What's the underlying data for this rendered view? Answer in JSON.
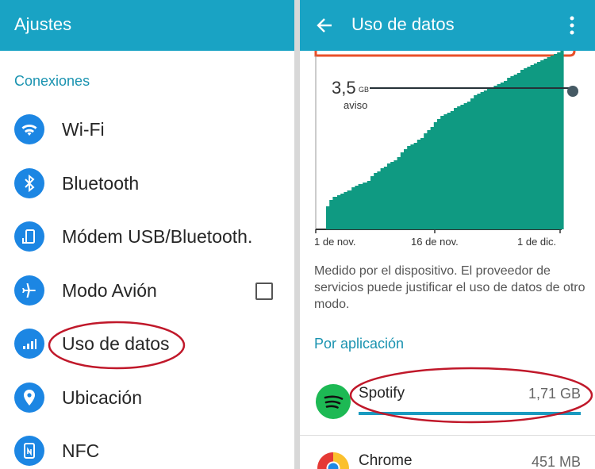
{
  "left": {
    "title": "Ajustes",
    "section": "Conexiones",
    "items": [
      {
        "label": "Wi-Fi",
        "icon": "wifi-icon"
      },
      {
        "label": "Bluetooth",
        "icon": "bluetooth-icon"
      },
      {
        "label": "Módem USB/Bluetooth.",
        "icon": "tethering-icon"
      },
      {
        "label": "Modo Avión",
        "icon": "airplane-icon",
        "checked": false
      },
      {
        "label": "Uso de datos",
        "icon": "data-usage-icon"
      },
      {
        "label": "Ubicación",
        "icon": "location-icon"
      },
      {
        "label": "NFC",
        "icon": "nfc-icon"
      }
    ]
  },
  "right": {
    "title": "Uso de datos",
    "chart_data": {
      "type": "area",
      "limit_value": "3,5",
      "limit_unit": "GB",
      "limit_label": "aviso",
      "x_ticks": [
        "1 de nov.",
        "16 de nov.",
        "1 de dic."
      ],
      "area_color": "#0f9a82"
    },
    "description": "Medido por el dispositivo. El proveedor de servicios puede justificar el uso de datos de otro modo.",
    "by_app_title": "Por aplicación",
    "apps": [
      {
        "name": "Spotify",
        "size": "1,71 GB",
        "usage_fraction": 0.93
      },
      {
        "name": "Chrome",
        "size": "451 MB"
      }
    ]
  },
  "colors": {
    "appbar": "#19a3c4",
    "accent_text": "#1a93b0",
    "icon_blue": "#1c86e3",
    "annotation": "#c0182a",
    "warning_line": "#e8502a"
  }
}
